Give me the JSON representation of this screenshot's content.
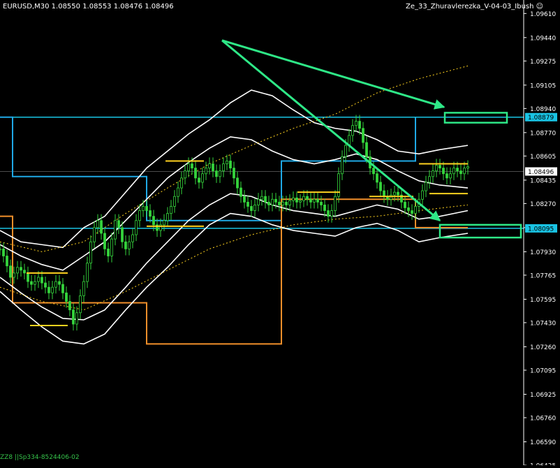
{
  "chart_data": {
    "type": "candlestick",
    "symbol_header": "EURUSD,M30  1.08550 1.08553 1.08476 1.08496",
    "indicator_name": "Ze_33_Zhuravlerezka_V-04-03_Ibush",
    "footer_text": "ZZ8 ||Sp334-8524406-02",
    "y_ticks": [
      "1.09610",
      "1.09440",
      "1.09275",
      "1.09105",
      "1.08940",
      "1.08770",
      "1.08605",
      "1.08435",
      "1.08270",
      "1.08100",
      "1.07930",
      "1.07765",
      "1.07595",
      "1.07430",
      "1.07260",
      "1.07095",
      "1.06925",
      "1.06760",
      "1.06590",
      "1.06425"
    ],
    "ylim": [
      1.06425,
      1.09705
    ],
    "price_labels": [
      {
        "value": "1.08879",
        "color": "#19c3e3"
      },
      {
        "value": "1.08496",
        "color": "#ffffff"
      },
      {
        "value": "1.08095",
        "color": "#19c3e3"
      }
    ],
    "grid": false,
    "colors": {
      "background": "#000000",
      "candles": "#35d43c",
      "bands": "#ffffff",
      "blue_levels": "#1fa9e6",
      "orange_levels": "#f28f2a",
      "yellow_marks": "#ffd21f",
      "arrows": "#2ee887"
    },
    "series": [
      {
        "name": "close",
        "x": [
          0,
          5,
          10,
          15,
          20,
          25,
          30,
          35,
          40,
          45,
          50,
          55,
          60,
          65,
          70,
          75,
          80,
          85,
          90,
          95,
          100,
          105,
          110,
          115,
          120,
          125,
          130,
          135,
          140,
          145,
          150,
          155,
          160,
          165,
          170,
          175,
          180,
          185,
          190,
          195,
          200,
          205,
          210,
          215,
          220,
          225,
          230,
          235,
          240,
          245,
          250,
          255,
          260,
          265,
          270,
          275,
          280,
          285,
          290,
          295,
          300,
          305,
          310,
          315,
          320,
          325,
          330,
          335,
          340,
          345,
          350,
          355,
          360,
          365,
          370,
          375,
          380,
          385,
          390,
          395,
          400,
          405,
          410,
          415,
          420,
          425,
          430,
          435,
          440,
          445,
          450,
          455,
          460,
          465,
          470,
          475,
          480,
          485,
          490,
          495,
          500,
          505,
          510,
          515,
          520,
          525,
          530,
          535,
          540,
          545,
          550,
          555,
          560,
          565,
          570,
          575,
          580,
          585,
          590,
          595,
          600,
          605,
          610,
          615,
          620,
          625,
          630,
          635,
          640,
          645,
          650,
          655,
          660,
          665,
          670
        ],
        "values": [
          1.0795,
          1.079,
          1.0783,
          1.0775,
          1.0778,
          1.0782,
          1.078,
          1.0778,
          1.0772,
          1.077,
          1.0772,
          1.0775,
          1.0771,
          1.0768,
          1.0764,
          1.0768,
          1.0772,
          1.077,
          1.0764,
          1.0758,
          1.0752,
          1.0742,
          1.075,
          1.0762,
          1.0772,
          1.0785,
          1.08,
          1.081,
          1.0815,
          1.0806,
          1.0795,
          1.079,
          1.0802,
          1.0815,
          1.081,
          1.08,
          1.0795,
          1.08,
          1.0805,
          1.0815,
          1.0822,
          1.0825,
          1.0822,
          1.0818,
          1.0812,
          1.0808,
          1.0812,
          1.0815,
          1.082,
          1.0825,
          1.0832,
          1.0838,
          1.0845,
          1.085,
          1.0855,
          1.0852,
          1.0845,
          1.0842,
          1.0848,
          1.0852,
          1.0855,
          1.085,
          1.0846,
          1.085,
          1.0855,
          1.0857,
          1.0852,
          1.0845,
          1.0838,
          1.0832,
          1.0828,
          1.0825,
          1.0822,
          1.0826,
          1.083,
          1.0832,
          1.0828,
          1.0826,
          1.083,
          1.0828,
          1.0826,
          1.0828,
          1.0826,
          1.0829,
          1.0831,
          1.0828,
          1.0829,
          1.0832,
          1.083,
          1.0828,
          1.083,
          1.0828,
          1.0826,
          1.0822,
          1.0818,
          1.0822,
          1.0832,
          1.0848,
          1.086,
          1.0868,
          1.0875,
          1.0882,
          1.0885,
          1.088,
          1.087,
          1.086,
          1.0852,
          1.0848,
          1.0842,
          1.0836,
          1.0832,
          1.083,
          1.0833,
          1.0835,
          1.0833,
          1.0828,
          1.0824,
          1.0822,
          1.082,
          1.0825,
          1.083,
          1.0836,
          1.0842,
          1.0846,
          1.085,
          1.0854,
          1.0852,
          1.0848,
          1.0845,
          1.0848,
          1.0852,
          1.085,
          1.0848,
          1.0852,
          1.0853
        ]
      },
      {
        "name": "band_outer_upper",
        "x": [
          0,
          30,
          60,
          90,
          120,
          150,
          180,
          210,
          240,
          270,
          300,
          330,
          360,
          390,
          420,
          450,
          480,
          510,
          540,
          570,
          600,
          630,
          670
        ],
        "values": [
          1.0808,
          1.08,
          1.0798,
          1.0796,
          1.081,
          1.0818,
          1.0835,
          1.0852,
          1.0864,
          1.0876,
          1.0886,
          1.0898,
          1.0907,
          1.0903,
          1.0893,
          1.0884,
          1.088,
          1.0878,
          1.0872,
          1.0864,
          1.0862,
          1.0865,
          1.0868
        ]
      },
      {
        "name": "band_outer_lower",
        "x": [
          0,
          30,
          60,
          90,
          120,
          150,
          180,
          210,
          240,
          270,
          300,
          330,
          360,
          390,
          420,
          450,
          480,
          510,
          540,
          570,
          600,
          630,
          670
        ],
        "values": [
          1.0765,
          1.0752,
          1.074,
          1.073,
          1.0728,
          1.0735,
          1.0752,
          1.0768,
          1.0782,
          1.0798,
          1.0812,
          1.082,
          1.0818,
          1.0812,
          1.0808,
          1.0806,
          1.0804,
          1.081,
          1.0813,
          1.0808,
          1.08,
          1.0803,
          1.0806
        ]
      },
      {
        "name": "band_inner_upper",
        "x": [
          0,
          30,
          60,
          90,
          120,
          150,
          180,
          210,
          240,
          270,
          300,
          330,
          360,
          390,
          420,
          450,
          480,
          510,
          540,
          570,
          600,
          630,
          670
        ],
        "values": [
          1.0798,
          1.079,
          1.0784,
          1.078,
          1.079,
          1.08,
          1.0815,
          1.083,
          1.0845,
          1.0856,
          1.0866,
          1.0874,
          1.0872,
          1.0864,
          1.0858,
          1.0855,
          1.0858,
          1.0862,
          1.0858,
          1.085,
          1.0843,
          1.084,
          1.0838
        ]
      },
      {
        "name": "band_inner_lower",
        "x": [
          0,
          30,
          60,
          90,
          120,
          150,
          180,
          210,
          240,
          270,
          300,
          330,
          360,
          390,
          420,
          450,
          480,
          510,
          540,
          570,
          600,
          630,
          670
        ],
        "values": [
          1.0775,
          1.0764,
          1.0754,
          1.0746,
          1.0745,
          1.0752,
          1.0768,
          1.0785,
          1.08,
          1.0815,
          1.0826,
          1.0834,
          1.0832,
          1.0826,
          1.0822,
          1.082,
          1.0818,
          1.0822,
          1.0826,
          1.0823,
          1.0816,
          1.0818,
          1.0822
        ]
      },
      {
        "name": "yellow_dotted_upper",
        "x": [
          0,
          60,
          120,
          180,
          240,
          300,
          360,
          420,
          480,
          540,
          600,
          670
        ],
        "values": [
          1.08,
          1.0793,
          1.08,
          1.082,
          1.0838,
          1.0855,
          1.0868,
          1.088,
          1.089,
          1.0905,
          1.0915,
          1.0924
        ]
      },
      {
        "name": "yellow_dotted_lower",
        "x": [
          0,
          60,
          120,
          180,
          240,
          300,
          360,
          420,
          480,
          540,
          600,
          670
        ],
        "values": [
          1.0768,
          1.0758,
          1.0752,
          1.0765,
          1.078,
          1.0795,
          1.0805,
          1.0812,
          1.0816,
          1.0818,
          1.0822,
          1.0826
        ]
      }
    ],
    "levels": {
      "blue_steps": [
        [
          0,
          1.08879
        ],
        [
          18,
          1.08879
        ],
        [
          18,
          1.0846
        ],
        [
          210,
          1.0846
        ],
        [
          210,
          1.0815
        ],
        [
          403,
          1.0815
        ],
        [
          403,
          1.0857
        ],
        [
          595,
          1.0857
        ],
        [
          595,
          1.08879
        ]
      ],
      "blue_h_lines": [
        1.08879,
        1.08095
      ],
      "orange_steps": [
        [
          0,
          1.0818
        ],
        [
          18,
          1.0818
        ],
        [
          18,
          1.0757
        ],
        [
          210,
          1.0757
        ],
        [
          210,
          1.0728
        ],
        [
          403,
          1.0728
        ],
        [
          403,
          1.083
        ],
        [
          595,
          1.083
        ],
        [
          595,
          1.081
        ],
        [
          670,
          1.081
        ]
      ],
      "yellow_segments": [
        [
          237,
          292,
          1.0857
        ],
        [
          600,
          670,
          1.0855
        ],
        [
          615,
          670,
          1.0834
        ],
        [
          38,
          97,
          1.0778
        ],
        [
          43,
          97,
          1.0741
        ],
        [
          210,
          292,
          1.0811
        ],
        [
          426,
          487,
          1.0835
        ],
        [
          529,
          592,
          1.0832
        ]
      ]
    },
    "annotations": [
      {
        "type": "arrow",
        "from": [
          318,
          1.0942
        ],
        "to": [
          636,
          1.0895
        ]
      },
      {
        "type": "arrow",
        "from": [
          318,
          1.0942
        ],
        "to": [
          630,
          1.0815
        ]
      },
      {
        "type": "box",
        "x0": 637,
        "x1": 726,
        "y0": 1.0891,
        "y1": 1.0884
      },
      {
        "type": "box",
        "x0": 630,
        "x1": 746,
        "y0": 1.0812,
        "y1": 1.0803
      }
    ]
  }
}
